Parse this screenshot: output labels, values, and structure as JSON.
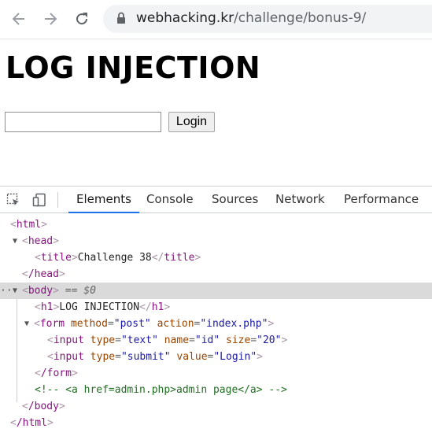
{
  "browser": {
    "url_host": "webhacking.kr",
    "url_path": "/challenge/bonus-9/"
  },
  "page": {
    "heading": "LOG INJECTION",
    "login_button": "Login",
    "id_value": ""
  },
  "devtools": {
    "tabs": [
      "Elements",
      "Console",
      "Sources",
      "Network",
      "Performance"
    ],
    "active_tab": "Elements",
    "selected_marker": "== $0",
    "dom_lines": {
      "html_open": "html",
      "head_open": "head",
      "title_tag": "title",
      "title_text": "Challenge 38",
      "head_close": "/head",
      "body_tag": "body",
      "h1_tag": "h1",
      "h1_text": "LOG INJECTION",
      "form_tag": "form",
      "form_method_attr": "method",
      "form_method_val": "\"post\"",
      "form_action_attr": "action",
      "form_action_val": "\"index.php\"",
      "input_tag": "input",
      "type_attr": "type",
      "input1_type_val": "\"text\"",
      "name_attr": "name",
      "input1_name_val": "\"id\"",
      "size_attr": "size",
      "input1_size_val": "\"20\"",
      "input2_type_val": "\"submit\"",
      "value_attr": "value",
      "input2_value_val": "\"Login\"",
      "form_close": "/form",
      "comment": "<!-- <a href=admin.php>admin page</a> -->",
      "body_close": "/body",
      "html_close": "/html"
    }
  }
}
